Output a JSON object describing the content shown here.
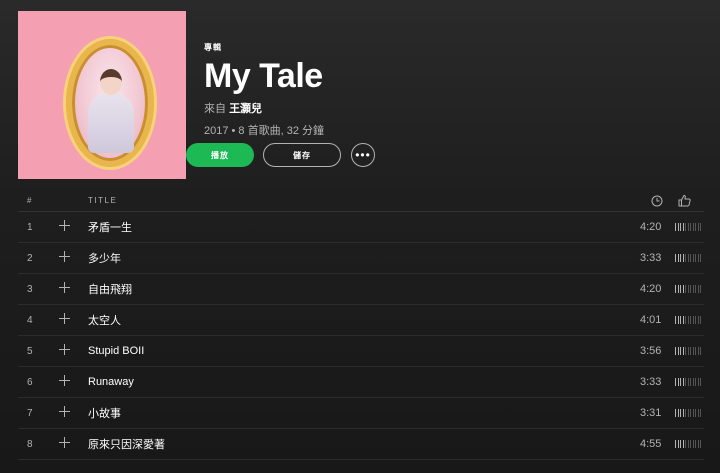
{
  "album": {
    "kind_label": "專輯",
    "title": "My Tale",
    "by_prefix": "來自",
    "artist": "王灝兒",
    "meta": "2017 • 8 首歌曲, 32 分鐘",
    "cover_colors": {
      "background": "#f4a0b2",
      "frame": "#e8b64a"
    }
  },
  "actions": {
    "play_label": "播放",
    "save_label": "儲存",
    "more_label": "•••"
  },
  "table": {
    "headers": {
      "num": "#",
      "title": "TITLE",
      "duration_icon": "clock-icon",
      "like_icon": "thumbs-up-icon"
    },
    "tracks": [
      {
        "num": "1",
        "title": "矛盾一生",
        "duration": "4:20",
        "popularity": 0.35
      },
      {
        "num": "2",
        "title": "多少年",
        "duration": "3:33",
        "popularity": 0.35
      },
      {
        "num": "3",
        "title": "自由飛翔",
        "duration": "4:20",
        "popularity": 0.35
      },
      {
        "num": "4",
        "title": "太空人",
        "duration": "4:01",
        "popularity": 0.35
      },
      {
        "num": "5",
        "title": "Stupid BOII",
        "duration": "3:56",
        "popularity": 0.35
      },
      {
        "num": "6",
        "title": "Runaway",
        "duration": "3:33",
        "popularity": 0.35
      },
      {
        "num": "7",
        "title": "小故事",
        "duration": "3:31",
        "popularity": 0.35
      },
      {
        "num": "8",
        "title": "原來只因深愛著",
        "duration": "4:55",
        "popularity": 0.35
      }
    ]
  },
  "colors": {
    "accent": "#1db954",
    "text_muted": "#b3b3b3",
    "background": "#181818"
  }
}
